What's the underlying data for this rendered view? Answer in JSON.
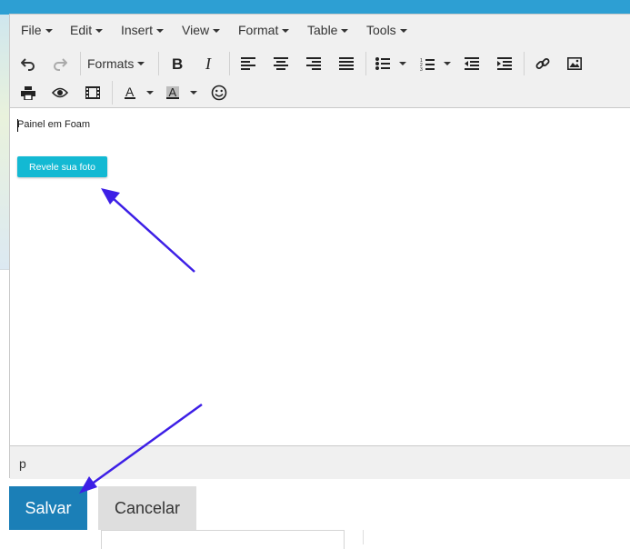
{
  "menubar": {
    "items": [
      "File",
      "Edit",
      "Insert",
      "View",
      "Format",
      "Table",
      "Tools"
    ]
  },
  "toolbar": {
    "formats_label": "Formats",
    "text_color_label": "A",
    "bg_color_label": "A",
    "icons": [
      "undo-icon",
      "redo-icon",
      "bold-icon",
      "italic-icon",
      "align-left-icon",
      "align-center-icon",
      "align-right-icon",
      "align-justify-icon",
      "bullet-list-icon",
      "numbered-list-icon",
      "outdent-icon",
      "indent-icon",
      "link-icon",
      "image-icon",
      "print-icon",
      "preview-icon",
      "media-icon",
      "emoticon-icon"
    ]
  },
  "content": {
    "paragraph": "Painel em Foam",
    "reveal_button": "Revele sua foto"
  },
  "statusbar": {
    "path": "p"
  },
  "actions": {
    "save": "Salvar",
    "cancel": "Cancelar"
  },
  "colors": {
    "accent": "#1b7fb7",
    "reveal_button": "#13b9d3",
    "annotation_arrow": "#3d1fe6",
    "toolbar_bg": "#f0f0f0"
  }
}
